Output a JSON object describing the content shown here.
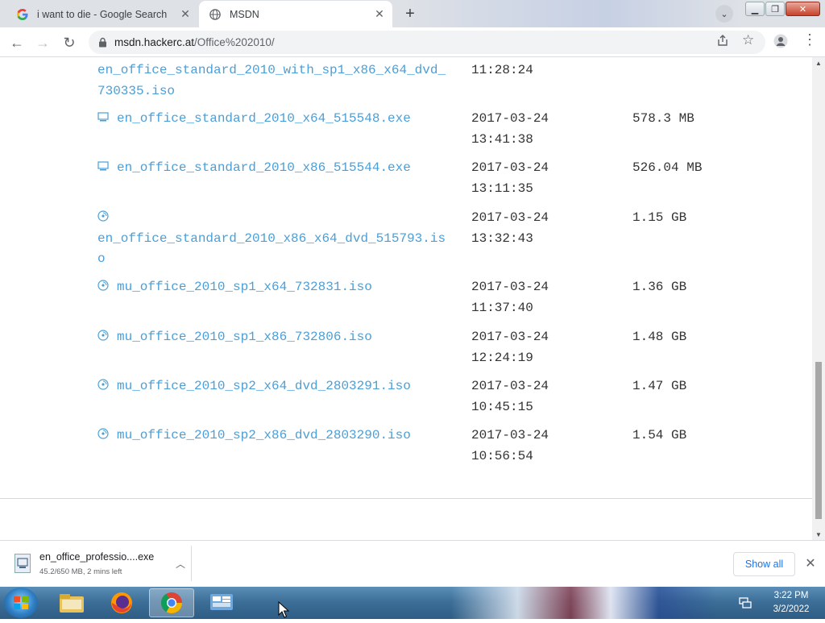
{
  "browser": {
    "tabs": [
      {
        "title": "i want to die - Google Search",
        "favicon": "google-g-icon",
        "active": false
      },
      {
        "title": "MSDN",
        "favicon": "globe-icon",
        "active": true
      }
    ],
    "url": {
      "host": "msdn.hackerc.at",
      "path": "/Office%202010/"
    }
  },
  "files": [
    {
      "name": "en_office_standard_2010_with_sp1_x86_x64_dvd_730335.iso",
      "date": "11:28:24",
      "size": "",
      "icon": ""
    },
    {
      "name": "en_office_standard_2010_x64_515548.exe",
      "date": "2017-03-24 13:41:38",
      "size": "578.3 MB",
      "icon": "exe-icon"
    },
    {
      "name": "en_office_standard_2010_x86_515544.exe",
      "date": "2017-03-24 13:11:35",
      "size": "526.04 MB",
      "icon": "exe-icon"
    },
    {
      "name": "en_office_standard_2010_x86_x64_dvd_515793.iso",
      "date": "2017-03-24 13:32:43",
      "size": "1.15 GB",
      "icon": "disc-icon"
    },
    {
      "name": "mu_office_2010_sp1_x64_732831.iso",
      "date": "2017-03-24 11:37:40",
      "size": "1.36 GB",
      "icon": "disc-icon"
    },
    {
      "name": "mu_office_2010_sp1_x86_732806.iso",
      "date": "2017-03-24 12:24:19",
      "size": "1.48 GB",
      "icon": "disc-icon"
    },
    {
      "name": "mu_office_2010_sp2_x64_dvd_2803291.iso",
      "date": "2017-03-24 10:45:15",
      "size": "1.47 GB",
      "icon": "disc-icon"
    },
    {
      "name": "mu_office_2010_sp2_x86_dvd_2803290.iso",
      "date": "2017-03-24 10:56:54",
      "size": "1.54 GB",
      "icon": "disc-icon"
    }
  ],
  "downloads": {
    "item": {
      "name": "en_office_professio....exe",
      "status": "45.2/650 MB, 2 mins left"
    },
    "show_all": "Show all"
  },
  "taskbar": {
    "apps": [
      "windows-explorer-icon",
      "firefox-icon",
      "chrome-icon",
      "control-panel-icon"
    ],
    "clock": {
      "time": "3:22 PM",
      "date": "3/2/2022"
    }
  },
  "colors": {
    "link": "#4a9fd8",
    "accent": "#1a73e8"
  }
}
